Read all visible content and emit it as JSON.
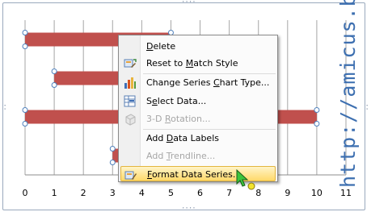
{
  "chart_data": {
    "type": "bar",
    "orientation": "horizontal",
    "x_ticks": [
      "0",
      "1",
      "2",
      "3",
      "4",
      "5",
      "6",
      "7",
      "8",
      "9",
      "10",
      "11"
    ],
    "xlim": [
      0,
      11
    ],
    "grid": true,
    "bars": [
      {
        "start": 0,
        "end": 5
      },
      {
        "start": 1,
        "end": 5
      },
      {
        "start": 0,
        "end": 10
      },
      {
        "start": 3,
        "end": 5
      }
    ],
    "bar_color": "#c0504d"
  },
  "watermark": "http://amicus.ba",
  "context_menu": {
    "items": [
      {
        "label": "Delete",
        "icon": "",
        "disabled": false,
        "underline_index": 0
      },
      {
        "label": "Reset to Match Style",
        "icon": "reset-style-icon",
        "disabled": false,
        "underline_index": 9
      },
      {
        "label": "Change Series Chart Type...",
        "icon": "chart-type-icon",
        "disabled": false,
        "underline_index": 14
      },
      {
        "label": "Select Data...",
        "icon": "select-data-icon",
        "disabled": false,
        "underline_index": 1
      },
      {
        "label": "3-D Rotation...",
        "icon": "rotation-icon",
        "disabled": true,
        "underline_index": 4
      },
      {
        "label": "Add Data Labels",
        "icon": "",
        "disabled": false,
        "underline_index": 4
      },
      {
        "label": "Add Trendline...",
        "icon": "",
        "disabled": true,
        "underline_index": 4
      },
      {
        "label": "Format Data Series...",
        "icon": "format-series-icon",
        "disabled": false,
        "underline_index": 0,
        "highlighted": true
      }
    ]
  }
}
